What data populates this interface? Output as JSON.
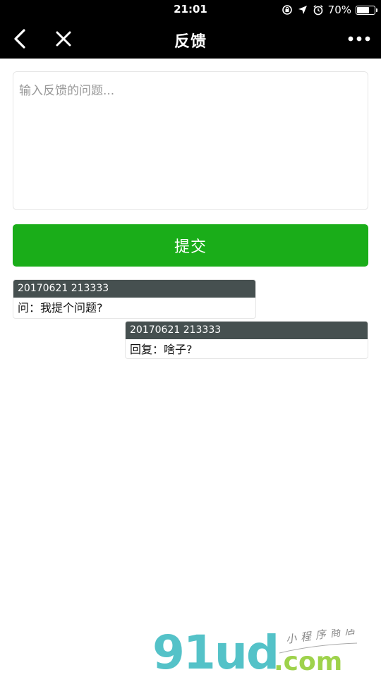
{
  "status_bar": {
    "time": "21:01",
    "battery_text": "70%",
    "battery_level": 0.7,
    "icons": [
      "rotation-lock-icon",
      "location-arrow-icon",
      "alarm-icon",
      "battery-icon"
    ]
  },
  "nav": {
    "title": "反馈",
    "icons": [
      "back-arrow-icon",
      "close-icon",
      "more-dots-icon"
    ]
  },
  "feedback": {
    "placeholder": "输入反馈的问题...",
    "value": ""
  },
  "submit": {
    "label": "提交"
  },
  "messages": [
    {
      "type": "question",
      "timestamp": "20170621 213333",
      "text": "问：我提个问题?"
    },
    {
      "type": "reply",
      "timestamp": "20170621 213333",
      "text": "回复：啥子?"
    }
  ],
  "watermark": {
    "logo_text": "91ud",
    "domain": ".com",
    "tagline": "小程序商店"
  },
  "colors": {
    "bar_background": "#000000",
    "submit_green": "#1aad19",
    "message_header": "#465050",
    "watermark_cyan": "#54c2c8",
    "watermark_green": "#9ed24b"
  }
}
